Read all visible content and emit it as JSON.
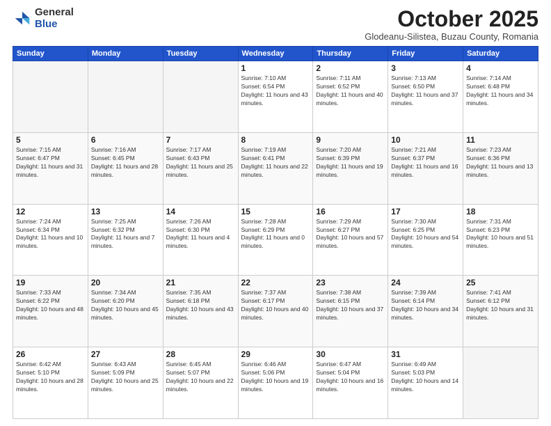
{
  "header": {
    "logo_general": "General",
    "logo_blue": "Blue",
    "month_title": "October 2025",
    "subtitle": "Glodeanu-Silistea, Buzau County, Romania"
  },
  "weekdays": [
    "Sunday",
    "Monday",
    "Tuesday",
    "Wednesday",
    "Thursday",
    "Friday",
    "Saturday"
  ],
  "weeks": [
    [
      {
        "day": "",
        "sunrise": "",
        "sunset": "",
        "daylight": "",
        "empty": true
      },
      {
        "day": "",
        "sunrise": "",
        "sunset": "",
        "daylight": "",
        "empty": true
      },
      {
        "day": "",
        "sunrise": "",
        "sunset": "",
        "daylight": "",
        "empty": true
      },
      {
        "day": "1",
        "sunrise": "Sunrise: 7:10 AM",
        "sunset": "Sunset: 6:54 PM",
        "daylight": "Daylight: 11 hours and 43 minutes.",
        "empty": false
      },
      {
        "day": "2",
        "sunrise": "Sunrise: 7:11 AM",
        "sunset": "Sunset: 6:52 PM",
        "daylight": "Daylight: 11 hours and 40 minutes.",
        "empty": false
      },
      {
        "day": "3",
        "sunrise": "Sunrise: 7:13 AM",
        "sunset": "Sunset: 6:50 PM",
        "daylight": "Daylight: 11 hours and 37 minutes.",
        "empty": false
      },
      {
        "day": "4",
        "sunrise": "Sunrise: 7:14 AM",
        "sunset": "Sunset: 6:48 PM",
        "daylight": "Daylight: 11 hours and 34 minutes.",
        "empty": false
      }
    ],
    [
      {
        "day": "5",
        "sunrise": "Sunrise: 7:15 AM",
        "sunset": "Sunset: 6:47 PM",
        "daylight": "Daylight: 11 hours and 31 minutes.",
        "empty": false
      },
      {
        "day": "6",
        "sunrise": "Sunrise: 7:16 AM",
        "sunset": "Sunset: 6:45 PM",
        "daylight": "Daylight: 11 hours and 28 minutes.",
        "empty": false
      },
      {
        "day": "7",
        "sunrise": "Sunrise: 7:17 AM",
        "sunset": "Sunset: 6:43 PM",
        "daylight": "Daylight: 11 hours and 25 minutes.",
        "empty": false
      },
      {
        "day": "8",
        "sunrise": "Sunrise: 7:19 AM",
        "sunset": "Sunset: 6:41 PM",
        "daylight": "Daylight: 11 hours and 22 minutes.",
        "empty": false
      },
      {
        "day": "9",
        "sunrise": "Sunrise: 7:20 AM",
        "sunset": "Sunset: 6:39 PM",
        "daylight": "Daylight: 11 hours and 19 minutes.",
        "empty": false
      },
      {
        "day": "10",
        "sunrise": "Sunrise: 7:21 AM",
        "sunset": "Sunset: 6:37 PM",
        "daylight": "Daylight: 11 hours and 16 minutes.",
        "empty": false
      },
      {
        "day": "11",
        "sunrise": "Sunrise: 7:23 AM",
        "sunset": "Sunset: 6:36 PM",
        "daylight": "Daylight: 11 hours and 13 minutes.",
        "empty": false
      }
    ],
    [
      {
        "day": "12",
        "sunrise": "Sunrise: 7:24 AM",
        "sunset": "Sunset: 6:34 PM",
        "daylight": "Daylight: 11 hours and 10 minutes.",
        "empty": false
      },
      {
        "day": "13",
        "sunrise": "Sunrise: 7:25 AM",
        "sunset": "Sunset: 6:32 PM",
        "daylight": "Daylight: 11 hours and 7 minutes.",
        "empty": false
      },
      {
        "day": "14",
        "sunrise": "Sunrise: 7:26 AM",
        "sunset": "Sunset: 6:30 PM",
        "daylight": "Daylight: 11 hours and 4 minutes.",
        "empty": false
      },
      {
        "day": "15",
        "sunrise": "Sunrise: 7:28 AM",
        "sunset": "Sunset: 6:29 PM",
        "daylight": "Daylight: 11 hours and 0 minutes.",
        "empty": false
      },
      {
        "day": "16",
        "sunrise": "Sunrise: 7:29 AM",
        "sunset": "Sunset: 6:27 PM",
        "daylight": "Daylight: 10 hours and 57 minutes.",
        "empty": false
      },
      {
        "day": "17",
        "sunrise": "Sunrise: 7:30 AM",
        "sunset": "Sunset: 6:25 PM",
        "daylight": "Daylight: 10 hours and 54 minutes.",
        "empty": false
      },
      {
        "day": "18",
        "sunrise": "Sunrise: 7:31 AM",
        "sunset": "Sunset: 6:23 PM",
        "daylight": "Daylight: 10 hours and 51 minutes.",
        "empty": false
      }
    ],
    [
      {
        "day": "19",
        "sunrise": "Sunrise: 7:33 AM",
        "sunset": "Sunset: 6:22 PM",
        "daylight": "Daylight: 10 hours and 48 minutes.",
        "empty": false
      },
      {
        "day": "20",
        "sunrise": "Sunrise: 7:34 AM",
        "sunset": "Sunset: 6:20 PM",
        "daylight": "Daylight: 10 hours and 45 minutes.",
        "empty": false
      },
      {
        "day": "21",
        "sunrise": "Sunrise: 7:35 AM",
        "sunset": "Sunset: 6:18 PM",
        "daylight": "Daylight: 10 hours and 43 minutes.",
        "empty": false
      },
      {
        "day": "22",
        "sunrise": "Sunrise: 7:37 AM",
        "sunset": "Sunset: 6:17 PM",
        "daylight": "Daylight: 10 hours and 40 minutes.",
        "empty": false
      },
      {
        "day": "23",
        "sunrise": "Sunrise: 7:38 AM",
        "sunset": "Sunset: 6:15 PM",
        "daylight": "Daylight: 10 hours and 37 minutes.",
        "empty": false
      },
      {
        "day": "24",
        "sunrise": "Sunrise: 7:39 AM",
        "sunset": "Sunset: 6:14 PM",
        "daylight": "Daylight: 10 hours and 34 minutes.",
        "empty": false
      },
      {
        "day": "25",
        "sunrise": "Sunrise: 7:41 AM",
        "sunset": "Sunset: 6:12 PM",
        "daylight": "Daylight: 10 hours and 31 minutes.",
        "empty": false
      }
    ],
    [
      {
        "day": "26",
        "sunrise": "Sunrise: 6:42 AM",
        "sunset": "Sunset: 5:10 PM",
        "daylight": "Daylight: 10 hours and 28 minutes.",
        "empty": false
      },
      {
        "day": "27",
        "sunrise": "Sunrise: 6:43 AM",
        "sunset": "Sunset: 5:09 PM",
        "daylight": "Daylight: 10 hours and 25 minutes.",
        "empty": false
      },
      {
        "day": "28",
        "sunrise": "Sunrise: 6:45 AM",
        "sunset": "Sunset: 5:07 PM",
        "daylight": "Daylight: 10 hours and 22 minutes.",
        "empty": false
      },
      {
        "day": "29",
        "sunrise": "Sunrise: 6:46 AM",
        "sunset": "Sunset: 5:06 PM",
        "daylight": "Daylight: 10 hours and 19 minutes.",
        "empty": false
      },
      {
        "day": "30",
        "sunrise": "Sunrise: 6:47 AM",
        "sunset": "Sunset: 5:04 PM",
        "daylight": "Daylight: 10 hours and 16 minutes.",
        "empty": false
      },
      {
        "day": "31",
        "sunrise": "Sunrise: 6:49 AM",
        "sunset": "Sunset: 5:03 PM",
        "daylight": "Daylight: 10 hours and 14 minutes.",
        "empty": false
      },
      {
        "day": "",
        "sunrise": "",
        "sunset": "",
        "daylight": "",
        "empty": true
      }
    ]
  ]
}
